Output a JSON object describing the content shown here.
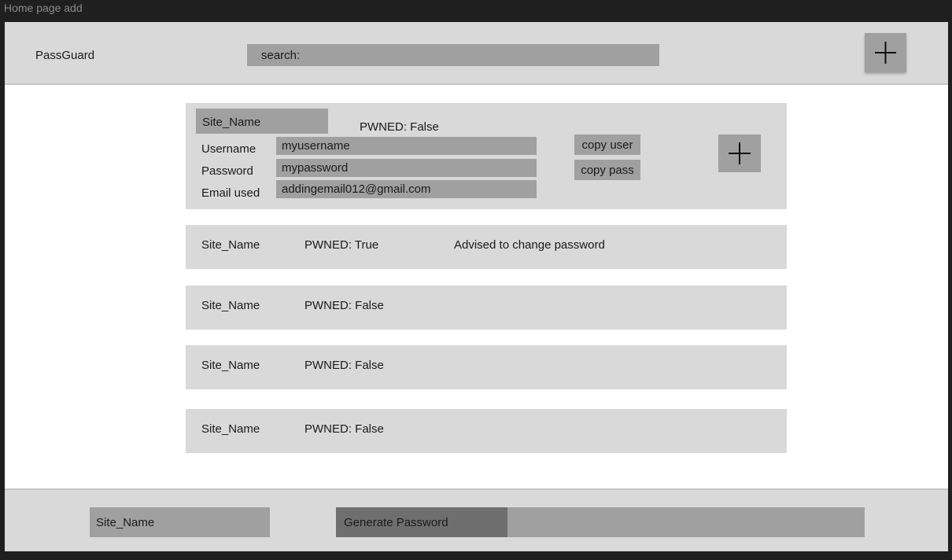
{
  "window": {
    "title": "Home page add"
  },
  "header": {
    "app_name": "PassGuard",
    "search_label": "search:",
    "add_icon": "plus-icon"
  },
  "expanded_entry": {
    "site_name": "Site_Name",
    "pwned": "PWNED: False",
    "username_label": "Username",
    "username_value": "myusername",
    "password_label": "Password",
    "password_value": "mypassword",
    "email_label": "Email used",
    "email_value": "addingemail012@gmail.com",
    "copy_user_label": "copy user",
    "copy_pass_label": "copy pass",
    "add_icon": "plus-icon"
  },
  "entries": [
    {
      "site_name": "Site_Name",
      "pwned": "PWNED: True",
      "advice": "Advised to change password"
    },
    {
      "site_name": "Site_Name",
      "pwned": "PWNED: False"
    },
    {
      "site_name": "Site_Name",
      "pwned": "PWNED: False"
    },
    {
      "site_name": "Site_Name",
      "pwned": "PWNED: False"
    }
  ],
  "footer": {
    "site_name": "Site_Name",
    "generate_label": "Generate Password"
  },
  "colors": {
    "panel": "#d9d9d9",
    "field": "#a0a0a0",
    "button_dark": "#6e6e6e",
    "outer": "#1f1f1f"
  }
}
